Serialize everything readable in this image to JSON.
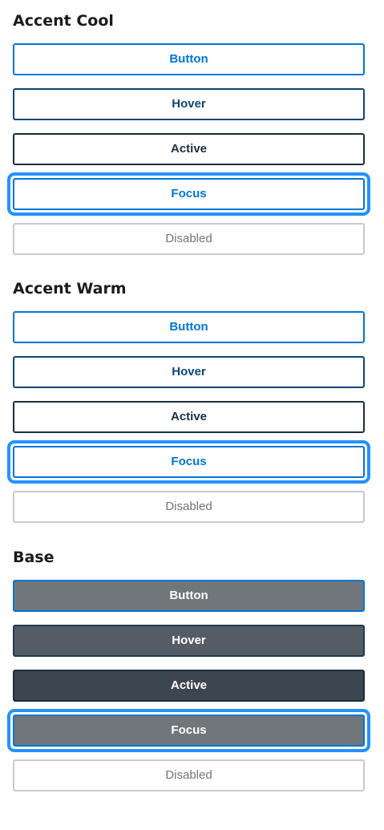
{
  "sections": [
    {
      "title": "Accent Cool",
      "buttons": [
        {
          "label": "Button",
          "state": "default"
        },
        {
          "label": "Hover",
          "state": "hover"
        },
        {
          "label": "Active",
          "state": "active"
        },
        {
          "label": "Focus",
          "state": "focus"
        },
        {
          "label": "Disabled",
          "state": "disabled"
        }
      ]
    },
    {
      "title": "Accent Warm",
      "buttons": [
        {
          "label": "Button",
          "state": "default"
        },
        {
          "label": "Hover",
          "state": "hover"
        },
        {
          "label": "Active",
          "state": "active"
        },
        {
          "label": "Focus",
          "state": "focus"
        },
        {
          "label": "Disabled",
          "state": "disabled"
        }
      ]
    },
    {
      "title": "Base",
      "buttons": [
        {
          "label": "Button",
          "state": "default"
        },
        {
          "label": "Hover",
          "state": "hover"
        },
        {
          "label": "Active",
          "state": "active"
        },
        {
          "label": "Focus",
          "state": "focus"
        },
        {
          "label": "Disabled",
          "state": "disabled"
        }
      ]
    }
  ],
  "colors": {
    "primary": "#0076d6",
    "hover": "#0b4778",
    "active": "#1a2e3f",
    "focus_ring": "#2491ff",
    "disabled_border": "#c9c9c9",
    "disabled_text": "#757575",
    "base_default": "#71767a",
    "base_hover": "#565c65",
    "base_active": "#3d4551"
  }
}
